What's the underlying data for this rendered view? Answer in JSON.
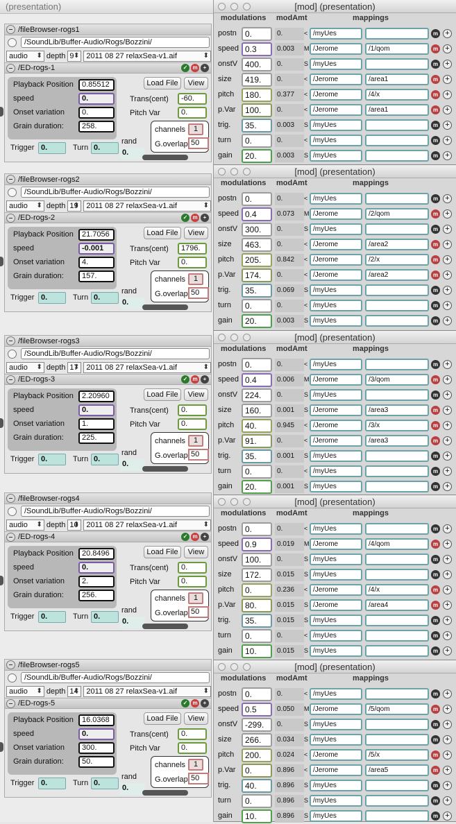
{
  "left_title": "(presentation)",
  "common": {
    "audio": "audio",
    "depth_label": "depth",
    "playback_label": "Playback Position",
    "speed_label": "speed",
    "onset_label": "Onset variation",
    "grain_label": "Grain duration:",
    "trans_label": "Trans(cent)",
    "pitchvar_label": "Pitch Var",
    "loadfile": "Load File",
    "view": "View",
    "channels_label": "channels",
    "goverlap_label": "G.overlap",
    "trigger_label": "Trigger",
    "turn_label": "Turn",
    "rand_label": "rand"
  },
  "modules": [
    {
      "fb": "/fileBrowser-rogs1",
      "path": "/SoundLib/Buffer-Audio/Rogs/Bozzini/",
      "depth": "9",
      "file": "2011 08 27 relaxSea-v1.aif",
      "ed": "/ED-rogs-1",
      "playback": "0.85512",
      "speed": "0.",
      "onset": "0.",
      "grain": "258.",
      "trans": "-60.",
      "pitchvar": "0.",
      "channels": "1",
      "goverlap": "50",
      "trigger": "0.",
      "turn": "0.",
      "rand": "0."
    },
    {
      "fb": "/fileBrowser-rogs2",
      "path": "/SoundLib/Buffer-Audio/Rogs/Bozzini/",
      "depth": "19",
      "file": "2011 08 27 relaxSea-v1.aif",
      "ed": "/ED-rogs-2",
      "playback": "21.7056",
      "speed": "-0.001",
      "onset": "4.",
      "grain": "157.",
      "trans": "1796.",
      "pitchvar": "0.",
      "channels": "1",
      "goverlap": "50",
      "trigger": "0.",
      "turn": "0.",
      "rand": "0."
    },
    {
      "fb": "/fileBrowser-rogs3",
      "path": "/SoundLib/Buffer-Audio/Rogs/Bozzini/",
      "depth": "17",
      "file": "2011 08 27 relaxSea-v1.aif",
      "ed": "/ED-rogs-3",
      "playback": "2.20960",
      "speed": "0.",
      "onset": "1.",
      "grain": "225.",
      "trans": "0.",
      "pitchvar": "0.",
      "channels": "1",
      "goverlap": "50",
      "trigger": "0.",
      "turn": "0.",
      "rand": "0."
    },
    {
      "fb": "/fileBrowser-rogs4",
      "path": "/SoundLib/Buffer-Audio/Rogs/Bozzini/",
      "depth": "10",
      "file": "2011 08 27 relaxSea-v1.aif",
      "ed": "/ED-rogs-4",
      "playback": "20.8496",
      "speed": "0.",
      "onset": "2.",
      "grain": "256.",
      "trans": "0.",
      "pitchvar": "0.",
      "channels": "1",
      "goverlap": "50",
      "trigger": "0.",
      "turn": "0.",
      "rand": "0."
    },
    {
      "fb": "/fileBrowser-rogs5",
      "path": "/SoundLib/Buffer-Audio/Rogs/Bozzini/",
      "depth": "14",
      "file": "2011 08 27 relaxSea-v1.aif",
      "ed": "/ED-rogs-5",
      "playback": "16.0368",
      "speed": "0.",
      "onset": "300.",
      "grain": "50.",
      "trans": "0.",
      "pitchvar": "0.",
      "channels": "1",
      "goverlap": "50",
      "trigger": "0.",
      "turn": "0.",
      "rand": "0."
    }
  ],
  "mod_headers": {
    "modulations": "modulations",
    "modamt": "modAmt",
    "mappings": "mappings"
  },
  "mod_windows": [
    {
      "title": "[mod] (presentation)",
      "rows": [
        {
          "name": "postn",
          "val": "0.",
          "amt": "0.",
          "flag": "<",
          "a": "/myUes",
          "b": "",
          "m": "k"
        },
        {
          "name": "speed",
          "val": "0.3",
          "amt": "0.003",
          "flag": "M",
          "a": "/Jerome",
          "b": "/1/qom",
          "m": "r"
        },
        {
          "name": "onstV",
          "val": "400.",
          "amt": "0.",
          "flag": "S",
          "a": "/myUes",
          "b": "",
          "m": "k"
        },
        {
          "name": "size",
          "val": "419.",
          "amt": "0.",
          "flag": "<",
          "a": "/Jerome",
          "b": "/area1",
          "m": "r"
        },
        {
          "name": "pitch",
          "val": "180.",
          "amt": "0.377",
          "flag": "<",
          "a": "/Jerome",
          "b": "/4/x",
          "m": "r"
        },
        {
          "name": "p.Var",
          "val": "100.",
          "amt": "0.",
          "flag": "<",
          "a": "/Jerome",
          "b": "/area1",
          "m": "r"
        },
        {
          "name": "trig.",
          "val": "35.",
          "amt": "0.003",
          "flag": "S",
          "a": "/myUes",
          "b": "",
          "m": "k"
        },
        {
          "name": "turn",
          "val": "0.",
          "amt": "0.",
          "flag": "<",
          "a": "/myUes",
          "b": "",
          "m": "k"
        },
        {
          "name": "gain",
          "val": "20.",
          "amt": "0.003",
          "flag": "S",
          "a": "/myUes",
          "b": "",
          "m": "k"
        }
      ]
    },
    {
      "title": "[mod] (presentation)",
      "rows": [
        {
          "name": "postn",
          "val": "0.",
          "amt": "0.",
          "flag": "<",
          "a": "/myUes",
          "b": "",
          "m": "k"
        },
        {
          "name": "speed",
          "val": "0.4",
          "amt": "0.073",
          "flag": "M",
          "a": "/Jerome",
          "b": "/2/qom",
          "m": "r"
        },
        {
          "name": "onstV",
          "val": "300.",
          "amt": "0.",
          "flag": "S",
          "a": "/myUes",
          "b": "",
          "m": "k"
        },
        {
          "name": "size",
          "val": "463.",
          "amt": "0.",
          "flag": "<",
          "a": "/Jerome",
          "b": "/area2",
          "m": "r"
        },
        {
          "name": "pitch",
          "val": "205.",
          "amt": "0.842",
          "flag": "<",
          "a": "/Jerome",
          "b": "/2/x",
          "m": "r"
        },
        {
          "name": "p.Var",
          "val": "174.",
          "amt": "0.",
          "flag": "<",
          "a": "/Jerome",
          "b": "/area2",
          "m": "r"
        },
        {
          "name": "trig.",
          "val": "35.",
          "amt": "0.069",
          "flag": "S",
          "a": "/myUes",
          "b": "",
          "m": "k"
        },
        {
          "name": "turn",
          "val": "0.",
          "amt": "0.",
          "flag": "<",
          "a": "/myUes",
          "b": "",
          "m": "k"
        },
        {
          "name": "gain",
          "val": "20.",
          "amt": "0.003",
          "flag": "S",
          "a": "/myUes",
          "b": "",
          "m": "k"
        }
      ]
    },
    {
      "title": "[mod] (presentation)",
      "rows": [
        {
          "name": "postn",
          "val": "0.",
          "amt": "0.",
          "flag": "<",
          "a": "/myUes",
          "b": "",
          "m": "k"
        },
        {
          "name": "speed",
          "val": "0.4",
          "amt": "0.006",
          "flag": "M",
          "a": "/Jerome",
          "b": "/3/qom",
          "m": "r"
        },
        {
          "name": "onstV",
          "val": "224.",
          "amt": "0.",
          "flag": "S",
          "a": "/myUes",
          "b": "",
          "m": "k"
        },
        {
          "name": "size",
          "val": "160.",
          "amt": "0.001",
          "flag": "S",
          "a": "/Jerome",
          "b": "/area3",
          "m": "r"
        },
        {
          "name": "pitch",
          "val": "40.",
          "amt": "0.945",
          "flag": "<",
          "a": "/Jerome",
          "b": "/3/x",
          "m": "r"
        },
        {
          "name": "p.Var",
          "val": "91.",
          "amt": "0.",
          "flag": "<",
          "a": "/Jerome",
          "b": "/area3",
          "m": "r"
        },
        {
          "name": "trig.",
          "val": "35.",
          "amt": "0.001",
          "flag": "S",
          "a": "/myUes",
          "b": "",
          "m": "k"
        },
        {
          "name": "turn",
          "val": "0.",
          "amt": "0.",
          "flag": "<",
          "a": "/myUes",
          "b": "",
          "m": "k"
        },
        {
          "name": "gain",
          "val": "20.",
          "amt": "0.001",
          "flag": "S",
          "a": "/myUes",
          "b": "",
          "m": "k"
        }
      ]
    },
    {
      "title": "[mod] (presentation)",
      "rows": [
        {
          "name": "postn",
          "val": "0.",
          "amt": "0.",
          "flag": "<",
          "a": "/myUes",
          "b": "",
          "m": "k"
        },
        {
          "name": "speed",
          "val": "0.9",
          "amt": "0.019",
          "flag": "M",
          "a": "/Jerome",
          "b": "/4/qom",
          "m": "r"
        },
        {
          "name": "onstV",
          "val": "100.",
          "amt": "0.",
          "flag": "S",
          "a": "/myUes",
          "b": "",
          "m": "k"
        },
        {
          "name": "size",
          "val": "172.",
          "amt": "0.015",
          "flag": "S",
          "a": "/myUes",
          "b": "",
          "m": "k"
        },
        {
          "name": "pitch",
          "val": "0.",
          "amt": "0.236",
          "flag": "<",
          "a": "/Jerome",
          "b": "/4/x",
          "m": "r"
        },
        {
          "name": "p.Var",
          "val": "80.",
          "amt": "0.015",
          "flag": "S",
          "a": "/Jerome",
          "b": "/area4",
          "m": "r"
        },
        {
          "name": "trig.",
          "val": "35.",
          "amt": "0.015",
          "flag": "S",
          "a": "/myUes",
          "b": "",
          "m": "k"
        },
        {
          "name": "turn",
          "val": "0.",
          "amt": "0.",
          "flag": "<",
          "a": "/myUes",
          "b": "",
          "m": "k"
        },
        {
          "name": "gain",
          "val": "10.",
          "amt": "0.015",
          "flag": "S",
          "a": "/myUes",
          "b": "",
          "m": "k"
        }
      ]
    },
    {
      "title": "[mod] (presentation)",
      "rows": [
        {
          "name": "postn",
          "val": "0.",
          "amt": "0.",
          "flag": "<",
          "a": "/myUes",
          "b": "",
          "m": "k"
        },
        {
          "name": "speed",
          "val": "0.5",
          "amt": "0.050",
          "flag": "M",
          "a": "/Jerome",
          "b": "/5/qom",
          "m": "r"
        },
        {
          "name": "onstV",
          "val": "-299.",
          "amt": "0.",
          "flag": "S",
          "a": "/myUes",
          "b": "",
          "m": "k"
        },
        {
          "name": "size",
          "val": "266.",
          "amt": "0.034",
          "flag": "S",
          "a": "/myUes",
          "b": "",
          "m": "k"
        },
        {
          "name": "pitch",
          "val": "200.",
          "amt": "0.024",
          "flag": "<",
          "a": "/Jerome",
          "b": "/5/x",
          "m": "r"
        },
        {
          "name": "p.Var",
          "val": "0.",
          "amt": "0.896",
          "flag": "<",
          "a": "/Jerome",
          "b": "/area5",
          "m": "r"
        },
        {
          "name": "trig.",
          "val": "40.",
          "amt": "0.896",
          "flag": "S",
          "a": "/myUes",
          "b": "",
          "m": "k"
        },
        {
          "name": "turn",
          "val": "0.",
          "amt": "0.896",
          "flag": "S",
          "a": "/myUes",
          "b": "",
          "m": "k"
        },
        {
          "name": "gain",
          "val": "10.",
          "amt": "0.896",
          "flag": "S",
          "a": "/myUes",
          "b": "",
          "m": "k"
        }
      ]
    }
  ]
}
